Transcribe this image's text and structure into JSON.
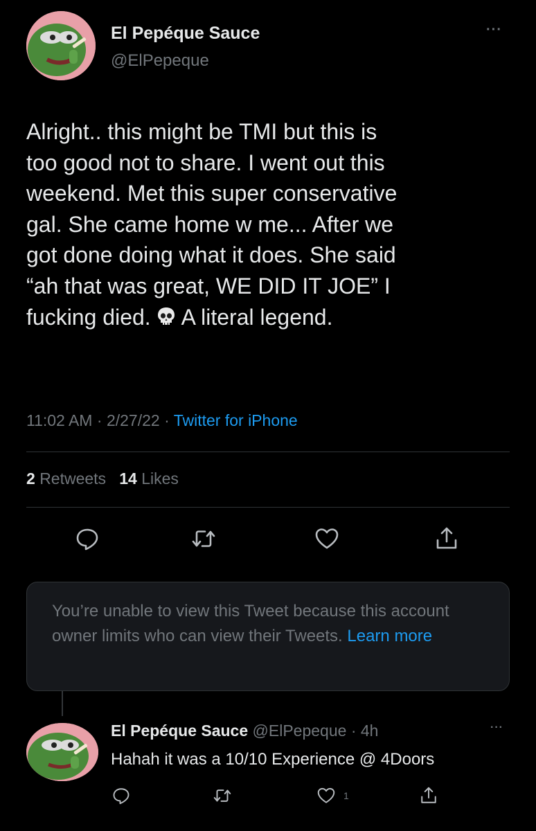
{
  "tweet": {
    "author_name": "El Pepéque Sauce",
    "author_handle": "@ElPepeque",
    "text_before_emoji": "Alright.. this might be TMI but this is\ntoo good not to share. I went out this\nweekend. Met this super conservative\ngal. She came home w me... After we\ngot done doing what it does. She said\n“ah that was great, WE DID IT JOE” I\nfucking died.",
    "emoji": "skull-emoji",
    "text_after_emoji": "A literal legend.",
    "time": "11:02 AM",
    "date": "2/27/22",
    "source": "Twitter for iPhone",
    "retweets_count": "2",
    "retweets_label": "Retweets",
    "likes_count": "14",
    "likes_label": "Likes",
    "more_label": "···"
  },
  "actions": [
    "reply-icon",
    "retweet-icon",
    "like-icon",
    "share-icon"
  ],
  "notice": {
    "text": "You’re unable to view this Tweet because this account owner limits who can view their Tweets.",
    "link": "Learn more"
  },
  "reply": {
    "author_name": "El Pepéque Sauce",
    "author_handle": "@ElPepeque",
    "separator": "·",
    "time_ago": "4h",
    "text": "Hahah it was a 10/10 Experience @ 4Doors",
    "like_count": "1",
    "more_label": "···"
  },
  "colors": {
    "background": "#000000",
    "text": "#e7e9ea",
    "secondary": "#71767b",
    "link": "#1d9bf0",
    "divider": "#2f3336"
  }
}
